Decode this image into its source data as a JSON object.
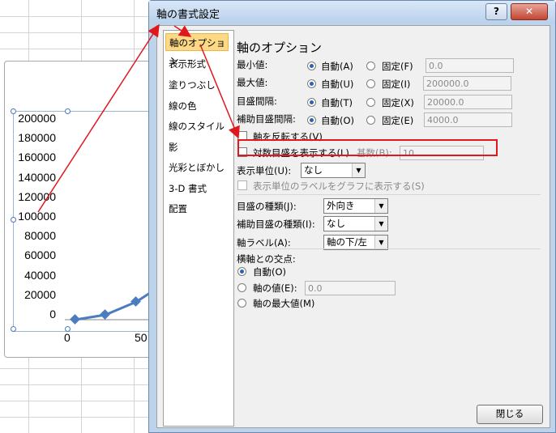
{
  "chart": {
    "ytick_labels": [
      "200000",
      "180000",
      "160000",
      "140000",
      "120000",
      "100000",
      "80000",
      "60000",
      "40000",
      "20000",
      "0"
    ],
    "xtick_labels": [
      "0",
      "50"
    ],
    "series_color": "#4a7cc0"
  },
  "dialog": {
    "title": "軸の書式設定",
    "help_label": "?",
    "close_x_label": "✕",
    "nav_items": [
      "軸のオプション",
      "表示形式",
      "塗りつぶし",
      "線の色",
      "線のスタイル",
      "影",
      "光彩とぼかし",
      "3-D 書式",
      "配置"
    ],
    "section_title": "軸のオプション",
    "rows": [
      {
        "label": "最小値:",
        "auto": "自動(A)",
        "fixed": "固定(F)",
        "value": "0.0"
      },
      {
        "label": "最大値:",
        "auto": "自動(U)",
        "fixed": "固定(I)",
        "value": "200000.0"
      },
      {
        "label": "目盛間隔:",
        "auto": "自動(T)",
        "fixed": "固定(X)",
        "value": "20000.0"
      },
      {
        "label": "補助目盛間隔:",
        "auto": "自動(O)",
        "fixed": "固定(E)",
        "value": "4000.0"
      }
    ],
    "reverse_label": "軸を反転する(V)",
    "log_label": "対数目盛を表示する(L)",
    "base_label": "基数(B):",
    "base_value": "10",
    "display_units_label": "表示単位(U):",
    "display_units_value": "なし",
    "show_units_label": "表示単位のラベルをグラフに表示する(S)",
    "major_tick_label": "目盛の種類(J):",
    "major_tick_value": "外向き",
    "minor_tick_label": "補助目盛の種類(I):",
    "minor_tick_value": "なし",
    "axis_labels_label": "軸ラベル(A):",
    "axis_labels_value": "軸の下/左",
    "crosses_title": "横軸との交点:",
    "crosses_auto": "自動(O)",
    "crosses_value_label": "軸の値(E):",
    "crosses_value": "0.0",
    "crosses_max": "軸の最大値(M)",
    "close_button": "閉じる"
  },
  "annotation_color": "#e0171d"
}
